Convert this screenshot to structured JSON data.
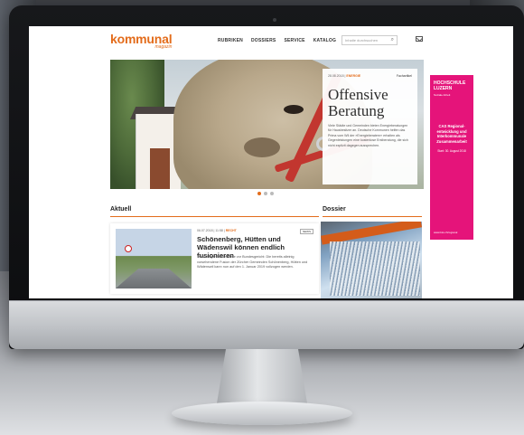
{
  "site": {
    "logo": "kommunal",
    "logo_sub": "magazin"
  },
  "nav": {
    "items": [
      "RUBRIKEN",
      "DOSSIERS",
      "SERVICE",
      "KATALOG"
    ]
  },
  "search": {
    "placeholder": "Inhalte durchsuchen"
  },
  "hero": {
    "meta_date": "28.08.2018 |",
    "meta_category": "ENERGIE",
    "tag": "Fachartikel",
    "title": "Offensive Beratung",
    "text": "Viele Städte und Gemeinden bieten Energieberatungen für Hausbesitzer an. Deutsche Kommunen helfen das Prima vom Wil der »Energieberatern« erhalten als Gegenleistungen eine kostenlose Erstberatung, die sich nicht explizit dagegen aussprechen."
  },
  "carousel": {
    "active_index": 0,
    "count": 3
  },
  "ad": {
    "brand": "HOCHSCHULE LUZERN",
    "dept": "Soziale Arbeit",
    "title": "CAS Regional-entwicklung und Interkommunale Zusammenarbeit",
    "date": "Start: 30. August 2018",
    "footer": "www.hslu.ch/regional"
  },
  "sections": {
    "aktuell": "Aktuell",
    "dossier": "Dossier"
  },
  "news": {
    "meta_date": "06.07.2018 | 11:58 |",
    "meta_category": "RECHT",
    "tag": "NEWS",
    "title": "Schönenberg, Hütten und Wädenswil können endlich fusionieren",
    "text": "Trotz fälliger Beschwerde vor Bundesgericht: Die bereits alleinig vorsehendene Fusion der Zürcher Gemeinden Schönenberg, Hütten und Wädenswil kann nun auf den 1. Januar 2019 vollzogen werden."
  },
  "colors": {
    "brand": "#e36c1b",
    "ad": "#e5147a"
  }
}
